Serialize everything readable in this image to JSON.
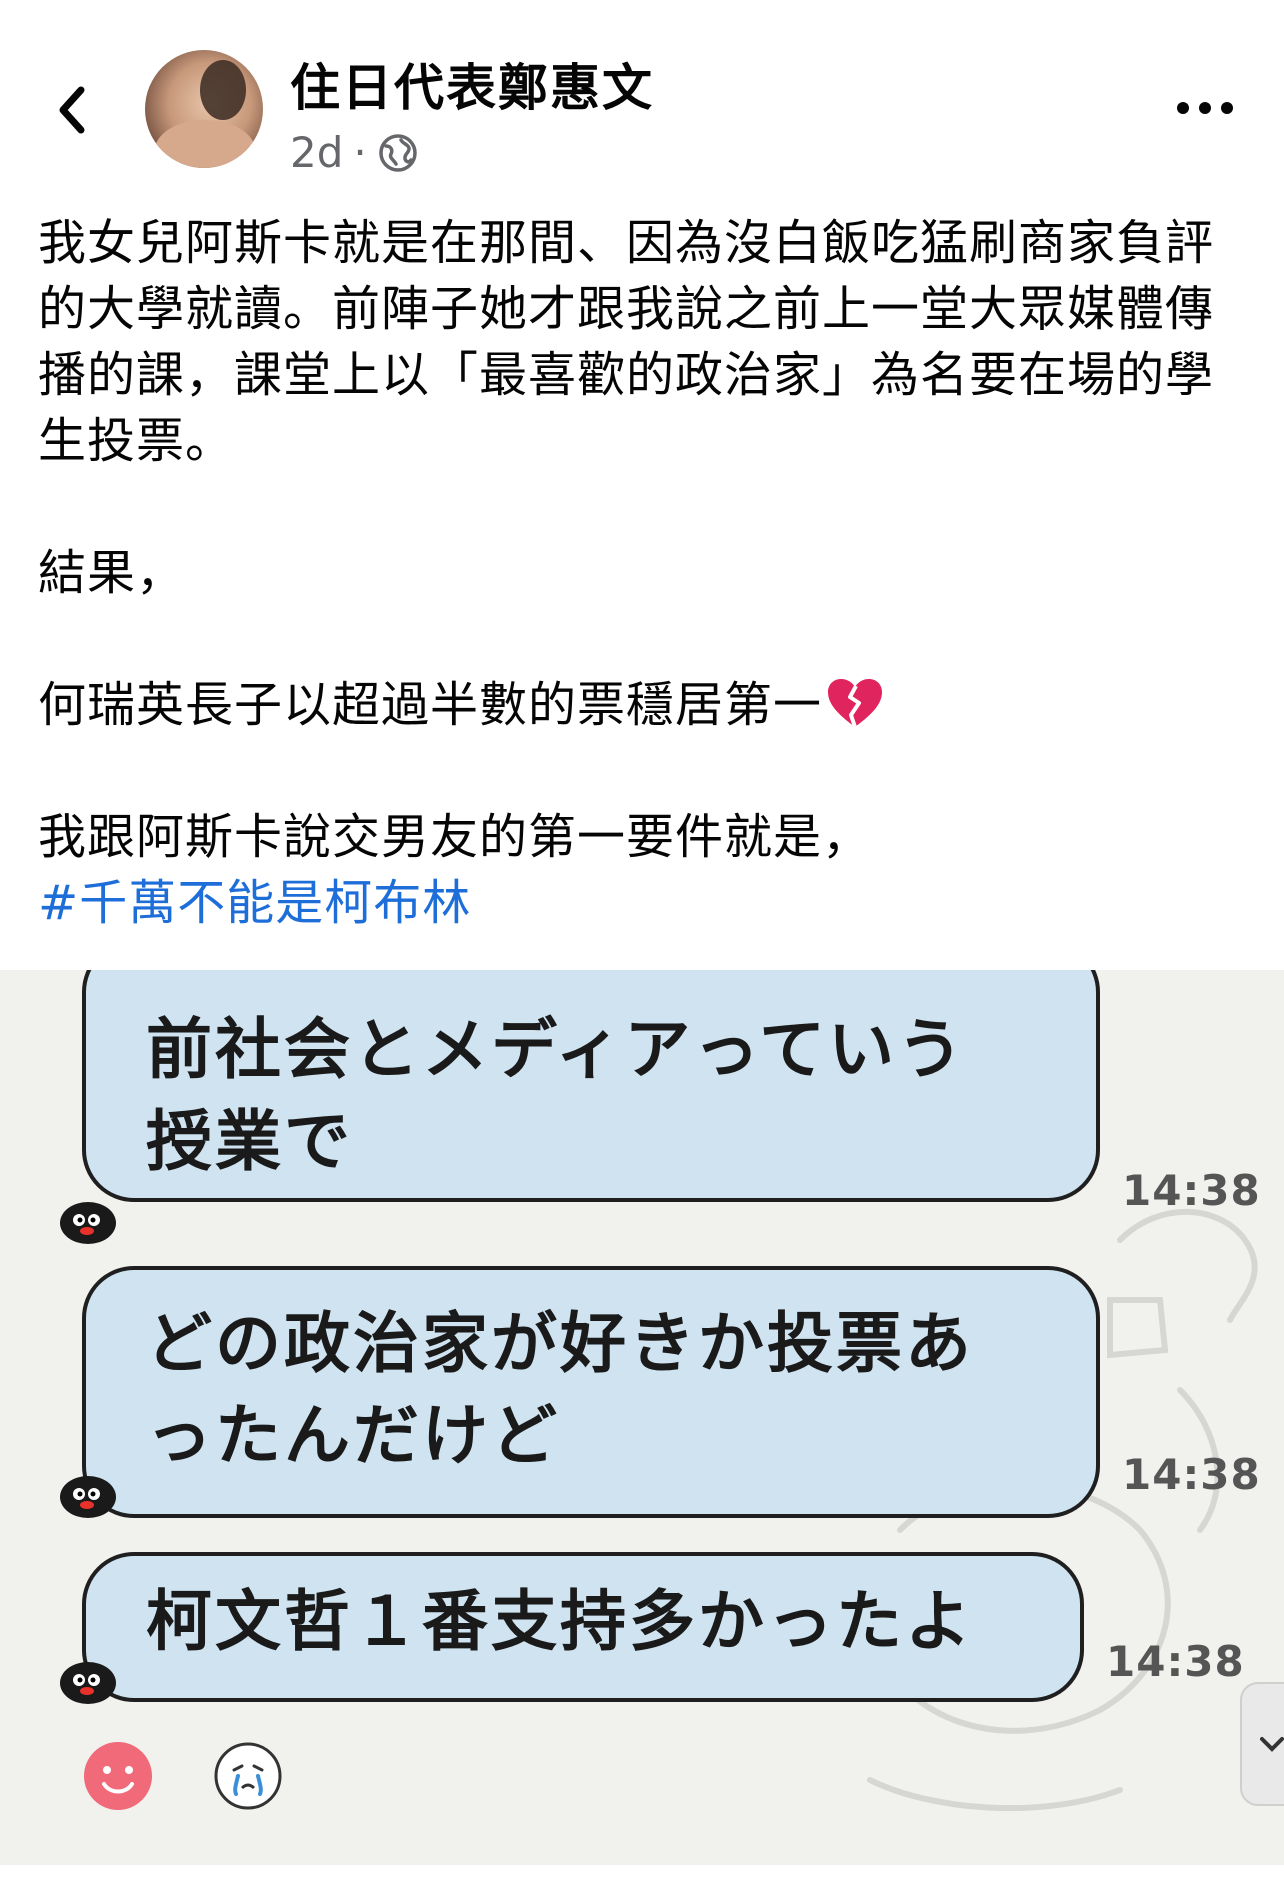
{
  "header": {
    "author": "住日代表鄭惠文",
    "time": "2d",
    "dot": "·",
    "icons": [
      "back-chevron-icon",
      "globe-icon",
      "more-dots-icon"
    ]
  },
  "post": {
    "paragraph1": "我女兒阿斯卡就是在那間、因為沒白飯吃猛刷商家負評的大學就讀。前陣子她才跟我說之前上一堂大眾媒體傳播的課，課堂上以「最喜歡的政治家」為名要在場的學生投票。",
    "paragraph2": "結果，",
    "paragraph3": "何瑞英長子以超過半數的票穩居第一",
    "paragraph3_emoji": "broken-heart-icon",
    "paragraph4": "我跟阿斯卡說交男友的第一要件就是，",
    "hashtag": "#千萬不能是柯布林"
  },
  "chat_image": {
    "messages": [
      {
        "line1": "前社会とメディアっていう",
        "line2": "授業で",
        "time": "14:38"
      },
      {
        "line1": "どの政治家が好きか投票あ",
        "line2": "ったんだけど",
        "time": "14:38"
      },
      {
        "line1": "柯文哲１番支持多かったよ",
        "time": "14:38"
      }
    ],
    "colors": {
      "bubble": "#cfe3f1",
      "background": "#f1f1ee",
      "hashtag": "#1d6ed8"
    }
  }
}
